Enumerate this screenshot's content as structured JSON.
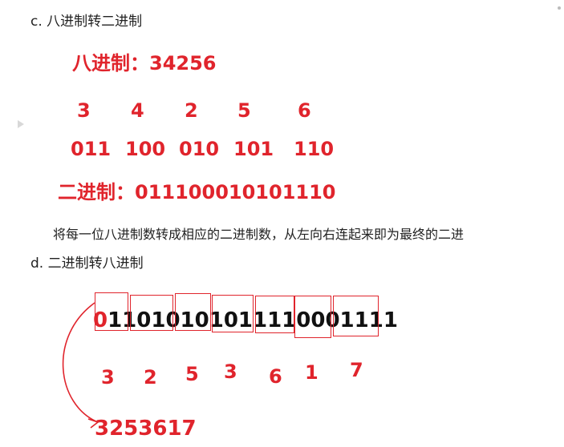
{
  "section_c": {
    "title": "c.  八进制转二进制",
    "octal_label": "八进制：34256",
    "octal_digits": [
      "3",
      "4",
      "2",
      "5",
      "6"
    ],
    "binary_groups": [
      "011",
      "100",
      "010",
      "101",
      "110"
    ],
    "binary_label": "二进制：011100010101110",
    "description": "将每一位八进制数转成相应的二进制数，从左向右连起来即为最终的二进"
  },
  "section_d": {
    "title": "d.  二进制转八进制",
    "binary_first": "0",
    "binary_rest": "11010101011110001111",
    "octal_digits": [
      "3",
      "2",
      "5",
      "3",
      "6",
      "1",
      "7"
    ],
    "result": "3253617"
  },
  "colors": {
    "accent_red": "#e0242c",
    "text": "#222222"
  }
}
